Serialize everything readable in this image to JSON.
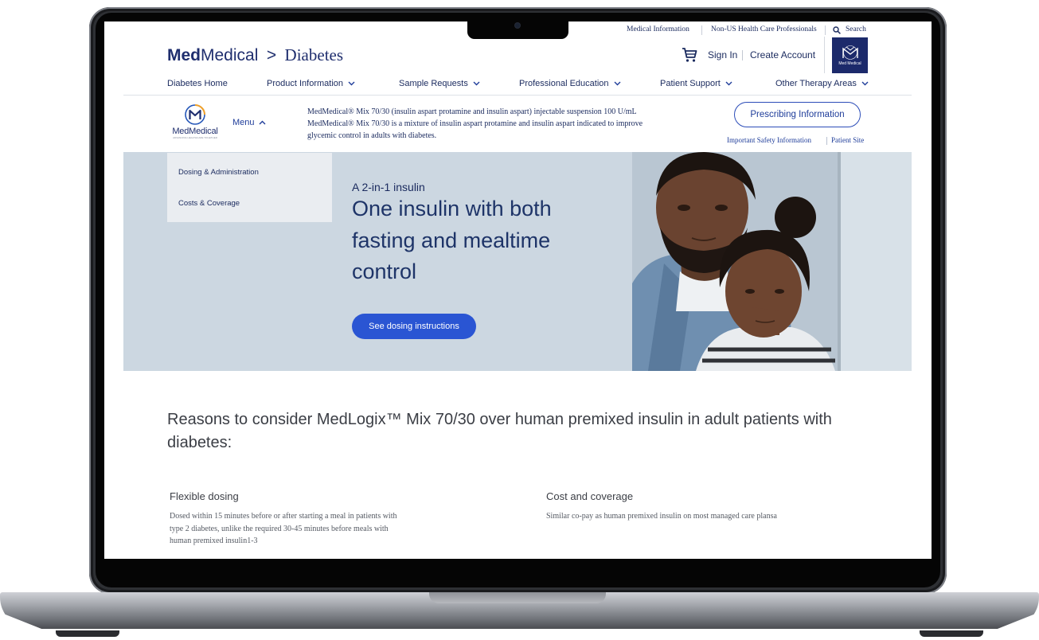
{
  "utility_nav": {
    "medical_information": "Medical Information",
    "non_us_hcp": "Non-US Health Care Professionals",
    "search": "Search"
  },
  "brand": {
    "name_bold": "Med",
    "name_regular": "Medical",
    "separator": ">",
    "section": "Diabetes",
    "badge_text": "Med Medical"
  },
  "account": {
    "sign_in": "Sign In",
    "create_account": "Create Account"
  },
  "main_nav": [
    {
      "label": "Diabetes Home"
    },
    {
      "label": "Product Information"
    },
    {
      "label": "Sample Requests"
    },
    {
      "label": "Professional Education"
    },
    {
      "label": "Patient Support"
    },
    {
      "label": "Other Therapy Areas"
    }
  ],
  "product_bar": {
    "logo_name": "MedMedical",
    "logo_tagline": "ADVANCING HEALTHCARE TOGETHER",
    "menu_label": "Menu",
    "description_line1": "MedMedical® Mix 70/30 (insulin aspart protamine and insulin aspart) injectable suspension 100 U/mL",
    "description_line2": "MedMedical® Mix 70/30 is a mixture of insulin aspart protamine and insulin aspart indicated to improve",
    "description_line3": "glycemic control in adults with diabetes.",
    "prescribing_info_button": "Prescribing Information",
    "important_safety_info": "Important Safety Information",
    "patient_site": "Patient Site"
  },
  "menu_dropdown": [
    {
      "label": "Dosing & Administration"
    },
    {
      "label": "Costs & Coverage"
    }
  ],
  "hero": {
    "eyebrow": "A 2-in-1 insulin",
    "title": "One insulin with both fasting and mealtime control",
    "cta": "See dosing instructions"
  },
  "reasons": {
    "heading": "Reasons to consider MedLogix™ Mix 70/30 over human premixed insulin in adult patients with diabetes:",
    "features": [
      {
        "title": "Flexible dosing",
        "body_line1": "Dosed within 15 minutes before or after starting a meal in patients with",
        "body_line2": "type 2 diabetes, unlike the required 30-45 minutes before meals with",
        "body_line3": "human premixed insulin1-3"
      },
      {
        "title": "Cost and coverage",
        "body_line1": "Similar co-pay as human premixed insulin on most managed care plansa"
      }
    ]
  },
  "colors": {
    "brand_navy": "#1f2e6e",
    "link_blue": "#1f3d9a",
    "cta_blue": "#2a55d3",
    "hero_bg": "#ccd7e1",
    "laptop_frame": "#2e3034"
  },
  "icons": {
    "search": "search-icon",
    "cart": "shopping-cart-icon",
    "chevron": "chevron-down-icon",
    "menu_chevron": "chevron-up-icon"
  }
}
